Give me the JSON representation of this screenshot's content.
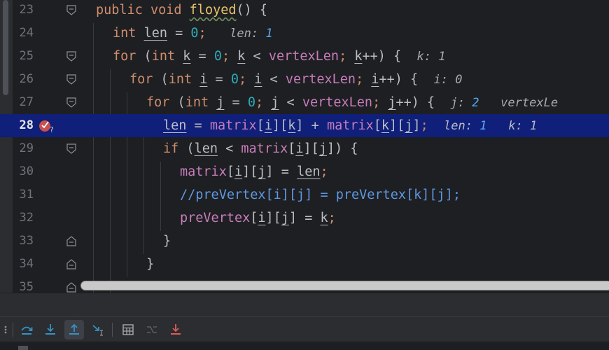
{
  "editor": {
    "lines": [
      {
        "number": "23"
      },
      {
        "number": "24",
        "hint": "len:",
        "hint_value": "1"
      },
      {
        "number": "25",
        "hint": "k:",
        "hint_value": "1"
      },
      {
        "number": "26",
        "hint": "i:",
        "hint_value": "0"
      },
      {
        "number": "27",
        "hint": "j:",
        "hint_value": "2",
        "hint2": "vertexLe"
      },
      {
        "number": "28",
        "hint": "len:",
        "hint_value": "1",
        "hint2": "k:",
        "hint2_value": "1"
      },
      {
        "number": "29"
      },
      {
        "number": "30"
      },
      {
        "number": "31"
      },
      {
        "number": "32"
      },
      {
        "number": "33"
      },
      {
        "number": "34"
      },
      {
        "number": "35"
      }
    ],
    "code": {
      "l23": {
        "kw1": "public",
        "kw2": "void",
        "fn": "floyed",
        "rest": "() {"
      },
      "l24": {
        "kw": "int",
        "var": "len",
        "eq": " = ",
        "num": "0",
        "semi": ";"
      },
      "l25": {
        "kw": "for",
        "p1": " (",
        "kw2": "int",
        "var": "k",
        "eq": " = ",
        "num": "0",
        "semi": ";",
        "var2": "k",
        "lt": " < ",
        "fld": "vertexLen",
        "semi2": ";",
        "var3": "k",
        "inc": "++) {"
      },
      "l26": {
        "kw": "for",
        "p1": " (",
        "kw2": "int",
        "var": "i",
        "eq": " = ",
        "num": "0",
        "semi": ";",
        "var2": "i",
        "lt": " < ",
        "fld": "vertexLen",
        "semi2": ";",
        "var3": "i",
        "inc": "++) {"
      },
      "l27": {
        "kw": "for",
        "p1": " (",
        "kw2": "int",
        "var": "j",
        "eq": " = ",
        "num": "0",
        "semi": ";",
        "var2": "j",
        "lt": " < ",
        "fld": "vertexLen",
        "semi2": ";",
        "var3": "j",
        "inc": "++) {"
      },
      "l28": {
        "var": "len",
        "eq": " = ",
        "fld": "matrix",
        "b1": "[",
        "i": "i",
        "b2": "][",
        "k": "k",
        "b3": "]",
        "plus": " + ",
        "fld2": "matrix",
        "b4": "[",
        "k2": "k",
        "b5": "][",
        "j": "j",
        "b6": "]",
        "semi": ";"
      },
      "l29": {
        "kw": "if",
        "p1": " (",
        "var": "len",
        "lt": " < ",
        "fld": "matrix",
        "b1": "[",
        "i": "i",
        "b2": "][",
        "j": "j",
        "b3": "]) {"
      },
      "l30": {
        "fld": "matrix",
        "b1": "[",
        "i": "i",
        "b2": "][",
        "j": "j",
        "b3": "]",
        "eq": " = ",
        "var": "len",
        "semi": ";"
      },
      "l31": {
        "cmt": "//preVertex[i][j] = preVertex[k][j];"
      },
      "l32": {
        "fld": "preVertex",
        "b1": "[",
        "i": "i",
        "b2": "][",
        "j": "j",
        "b3": "]",
        "eq": " = ",
        "var": "k",
        "semi": ";"
      },
      "l33": {
        "brace": "}"
      },
      "l34": {
        "brace": "}"
      }
    }
  },
  "breakpoint": {
    "icon": "breakpoint-icon",
    "color": "#c94f4f"
  },
  "toolbar": {
    "buttons": [
      {
        "name": "more-icon"
      },
      {
        "name": "step-over-icon"
      },
      {
        "name": "step-into-icon"
      },
      {
        "name": "step-out-icon"
      },
      {
        "name": "run-to-cursor-icon"
      },
      {
        "name": "evaluate-expression-icon"
      },
      {
        "name": "trace-current-stream-icon"
      },
      {
        "name": "force-step-icon"
      }
    ],
    "accent": "#3592c4"
  }
}
